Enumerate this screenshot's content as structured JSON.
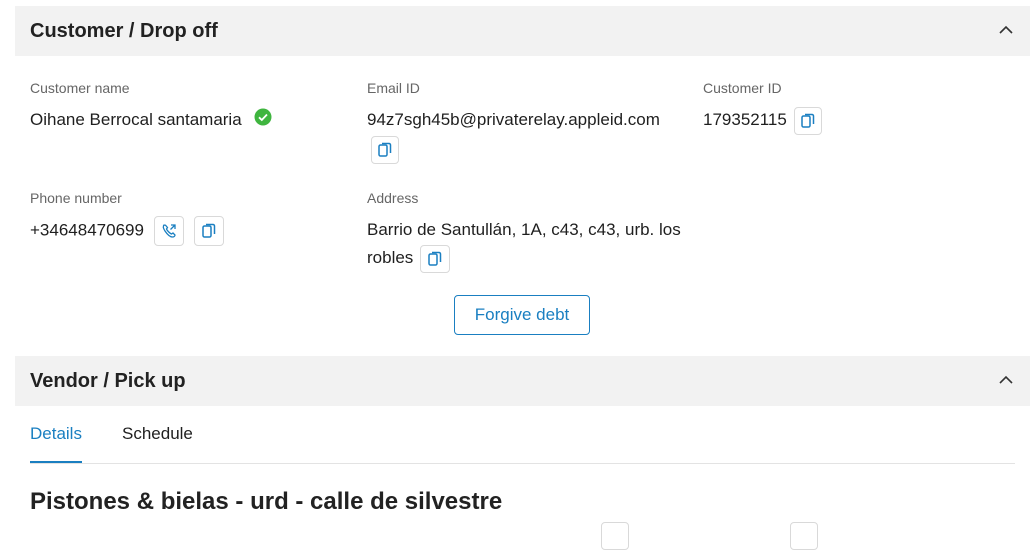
{
  "customer_section": {
    "title": "Customer / Drop off",
    "fields": {
      "customer_name_label": "Customer name",
      "customer_name": "Oihane Berrocal santamaria",
      "email_label": "Email ID",
      "email": "94z7sgh45b@privaterelay.appleid.com",
      "customer_id_label": "Customer ID",
      "customer_id": "179352115",
      "phone_label": "Phone number",
      "phone": "+34648470699",
      "address_label": "Address",
      "address_line1": "Barrio de Santullán, 1A, c43, c43, urb. los",
      "address_line2": "robles"
    },
    "forgive_debt_label": "Forgive debt"
  },
  "vendor_section": {
    "title": "Vendor / Pick up",
    "tabs": [
      "Details",
      "Schedule"
    ],
    "active_tab": "Details",
    "vendor_name": "Pistones & bielas - urd - calle de silvestre"
  },
  "colors": {
    "accent": "#1a7fc1",
    "verified": "#3fb53f",
    "header_bg": "#f2f2f2"
  },
  "icons": [
    "chevron-up-icon",
    "verified-check-icon",
    "copy-icon",
    "phone-call-icon"
  ]
}
